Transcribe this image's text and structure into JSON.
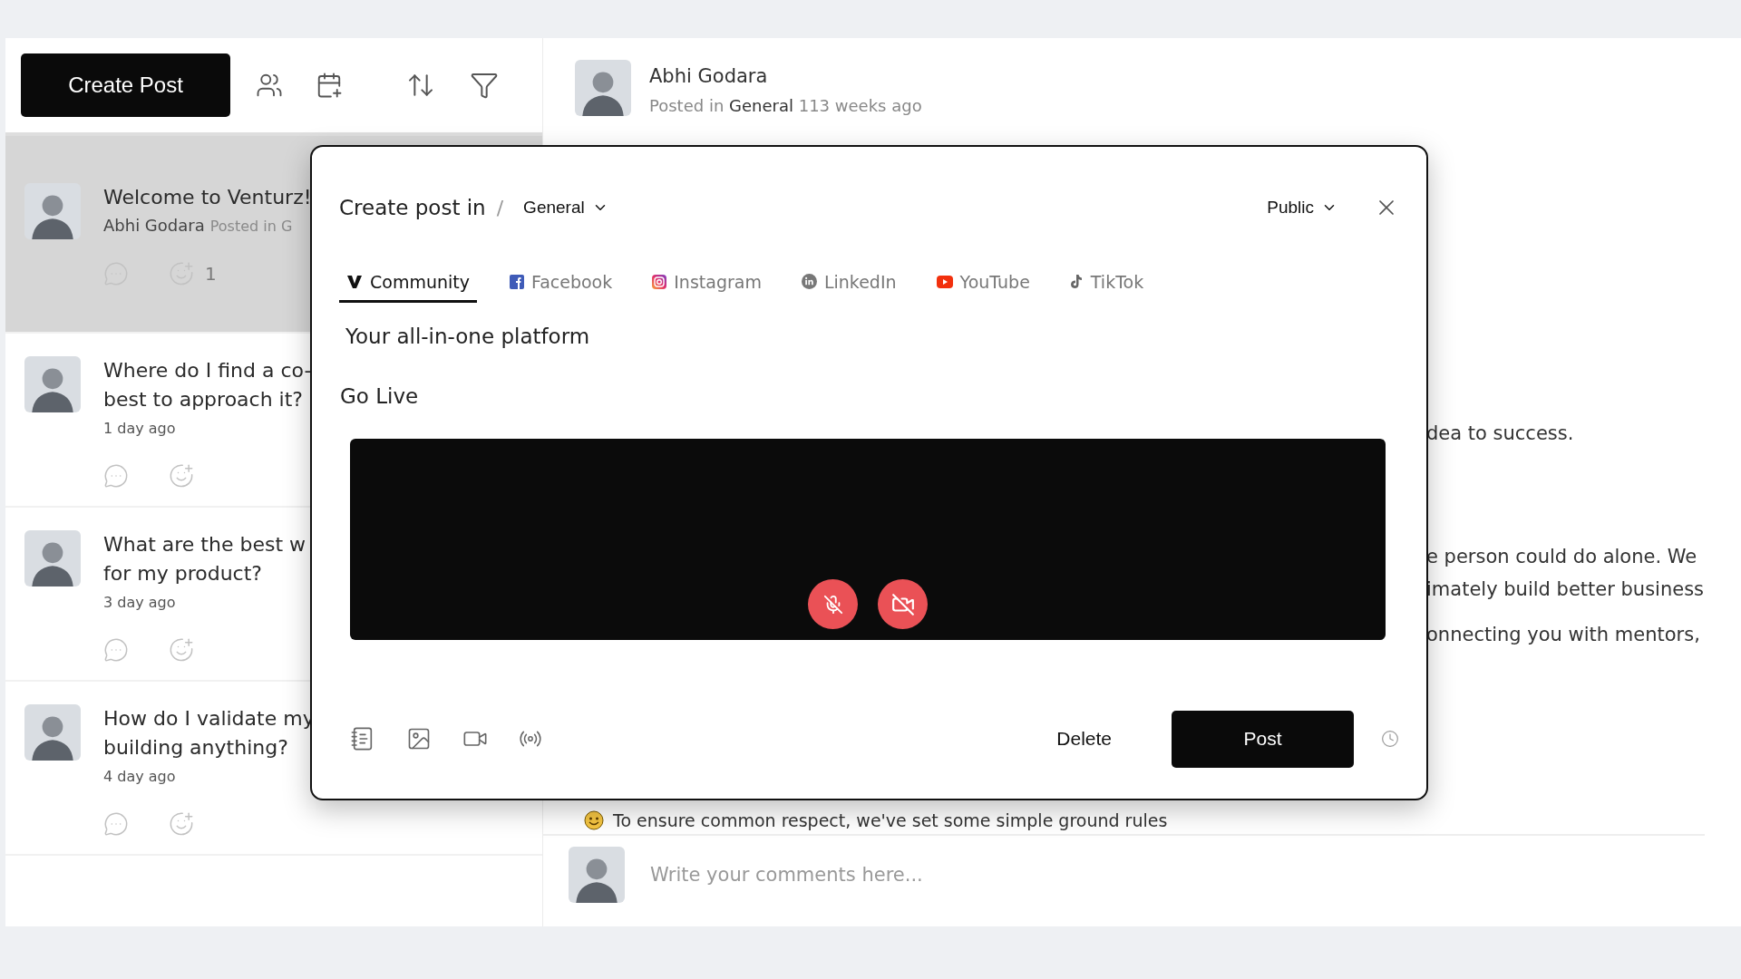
{
  "toolbar": {
    "create_button": "Create Post"
  },
  "posts": [
    {
      "selected": true,
      "title_lines": [
        "Welcome to Venturz!"
      ],
      "author": "Abhi Godara",
      "meta": "Posted in G",
      "reaction_count": "1"
    },
    {
      "selected": false,
      "title_lines": [
        "Where do I find a co-",
        "best to approach it?"
      ],
      "meta": "1 day ago"
    },
    {
      "selected": false,
      "title_lines": [
        "What are the best w",
        "for my product?"
      ],
      "meta": "3 day ago"
    },
    {
      "selected": false,
      "title_lines": [
        "How do I validate my",
        "building anything?"
      ],
      "meta": "4  day ago"
    }
  ],
  "detail": {
    "author": "Abhi Godara",
    "posted_prefix": "Posted in",
    "channel": "General",
    "time": "113 weeks ago",
    "paragraphs": [
      [
        "dea to success."
      ],
      [
        "e person could do alone. We",
        "imately build better business"
      ],
      [
        "onnecting you with mentors,"
      ]
    ],
    "rules_line": "To ensure common respect, we've set some simple ground rules",
    "comment_placeholder": "Write your comments here..."
  },
  "modal": {
    "title": "Create post in",
    "separator": "/",
    "channel": "General",
    "audience": "Public",
    "tabs": [
      {
        "kind": "community",
        "label": "Community",
        "selected": true
      },
      {
        "kind": "facebook",
        "label": "Facebook",
        "selected": false
      },
      {
        "kind": "instagram",
        "label": "Instagram",
        "selected": false
      },
      {
        "kind": "linkedin",
        "label": "LinkedIn",
        "selected": false
      },
      {
        "kind": "youtube",
        "label": "YouTube",
        "selected": false
      },
      {
        "kind": "tiktok",
        "label": "TikTok",
        "selected": false
      }
    ],
    "body_text": "Your all-in-one platform",
    "section_title": "Go Live",
    "delete_button": "Delete",
    "post_button": "Post"
  }
}
